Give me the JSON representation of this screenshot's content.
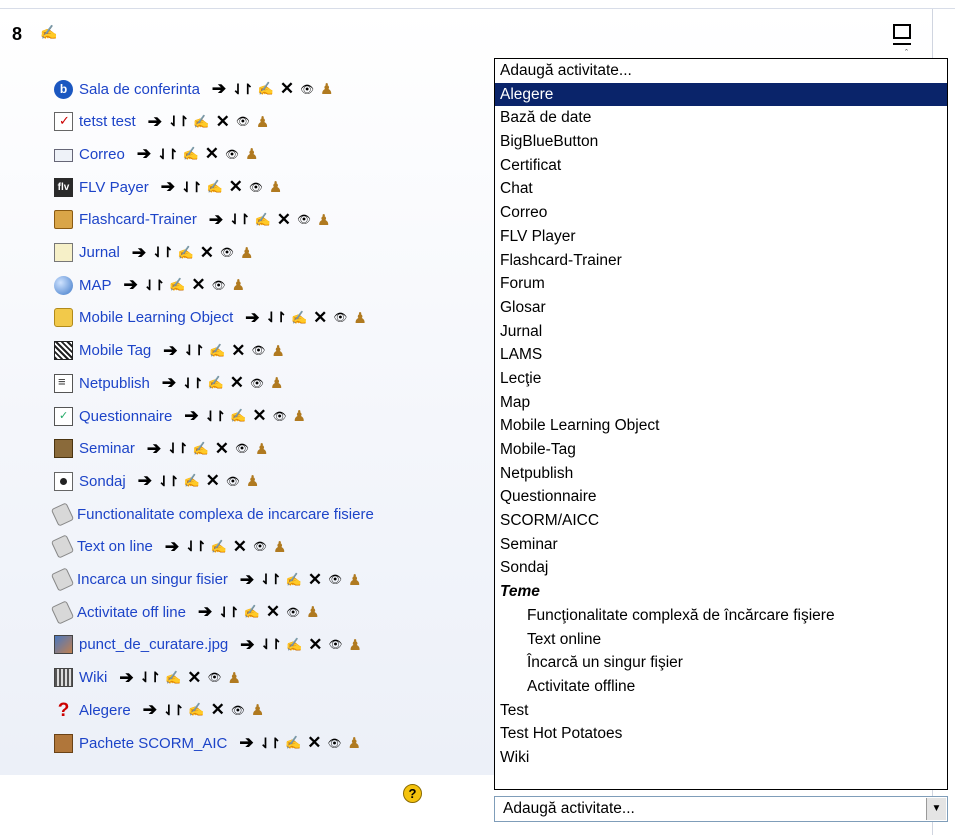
{
  "section": {
    "number": "8",
    "edit_icon": "edit-icon",
    "collapse_icon": "collapse-icon"
  },
  "activities": [
    {
      "name": "Sala de conferinta",
      "icon": "bigbluebutton-icon"
    },
    {
      "name": "tetst test",
      "icon": "quiz-icon"
    },
    {
      "name": "Correo",
      "icon": "envelope-icon"
    },
    {
      "name": "FLV Payer",
      "icon": "flv-icon"
    },
    {
      "name": "Flashcard-Trainer",
      "icon": "flashcard-icon"
    },
    {
      "name": "Jurnal",
      "icon": "journal-icon"
    },
    {
      "name": "MAP",
      "icon": "globe-icon"
    },
    {
      "name": "Mobile Learning Object",
      "icon": "cube-icon"
    },
    {
      "name": "Mobile Tag",
      "icon": "qr-icon"
    },
    {
      "name": "Netpublish",
      "icon": "page-icon"
    },
    {
      "name": "Questionnaire",
      "icon": "questionnaire-icon"
    },
    {
      "name": "Seminar",
      "icon": "seminar-icon"
    },
    {
      "name": "Sondaj",
      "icon": "poll-icon"
    },
    {
      "name": "Functionalitate complexa de incarcare fisiere",
      "icon": "assignment-icon"
    },
    {
      "name": "Text on line",
      "icon": "assignment-icon"
    },
    {
      "name": "Incarca un singur fisier",
      "icon": "assignment-icon"
    },
    {
      "name": "Activitate off line",
      "icon": "assignment-icon"
    },
    {
      "name": "punct_de_curatare.jpg",
      "icon": "image-icon"
    },
    {
      "name": "Wiki",
      "icon": "wiki-icon"
    },
    {
      "name": "Alegere",
      "icon": "question-icon"
    },
    {
      "name": "Pachete SCORM_AIC",
      "icon": "package-icon"
    }
  ],
  "controls": {
    "move": "➔",
    "updown": "⇃↾",
    "edit": "✍",
    "delete": "✕",
    "show": "👁",
    "role": "♟"
  },
  "dropdown": {
    "options": [
      {
        "label": "Adaugă activitate...",
        "kind": "plain"
      },
      {
        "label": "Alegere",
        "kind": "selected"
      },
      {
        "label": "Bază de date",
        "kind": "plain"
      },
      {
        "label": "BigBlueButton",
        "kind": "plain"
      },
      {
        "label": "Certificat",
        "kind": "plain"
      },
      {
        "label": "Chat",
        "kind": "plain"
      },
      {
        "label": "Correo",
        "kind": "plain"
      },
      {
        "label": "FLV Player",
        "kind": "plain"
      },
      {
        "label": "Flashcard-Trainer",
        "kind": "plain"
      },
      {
        "label": "Forum",
        "kind": "plain"
      },
      {
        "label": "Glosar",
        "kind": "plain"
      },
      {
        "label": "Jurnal",
        "kind": "plain"
      },
      {
        "label": "LAMS",
        "kind": "plain"
      },
      {
        "label": "Lecţie",
        "kind": "plain"
      },
      {
        "label": "Map",
        "kind": "plain"
      },
      {
        "label": "Mobile Learning Object",
        "kind": "plain"
      },
      {
        "label": "Mobile-Tag",
        "kind": "plain"
      },
      {
        "label": "Netpublish",
        "kind": "plain"
      },
      {
        "label": "Questionnaire",
        "kind": "plain"
      },
      {
        "label": "SCORM/AICC",
        "kind": "plain"
      },
      {
        "label": "Seminar",
        "kind": "plain"
      },
      {
        "label": "Sondaj",
        "kind": "plain"
      },
      {
        "label": "Teme",
        "kind": "group"
      },
      {
        "label": "Funcţionalitate complexă de încărcare fişiere",
        "kind": "sub"
      },
      {
        "label": "Text online",
        "kind": "sub"
      },
      {
        "label": "Încarcă un singur fişier",
        "kind": "sub"
      },
      {
        "label": "Activitate offline",
        "kind": "sub"
      },
      {
        "label": "Test",
        "kind": "plain"
      },
      {
        "label": "Test Hot Potatoes",
        "kind": "plain"
      },
      {
        "label": "Wiki",
        "kind": "plain"
      }
    ],
    "combo_value": "Adaugă activitate...",
    "arrow": "▼"
  },
  "help": {
    "label": "?"
  }
}
